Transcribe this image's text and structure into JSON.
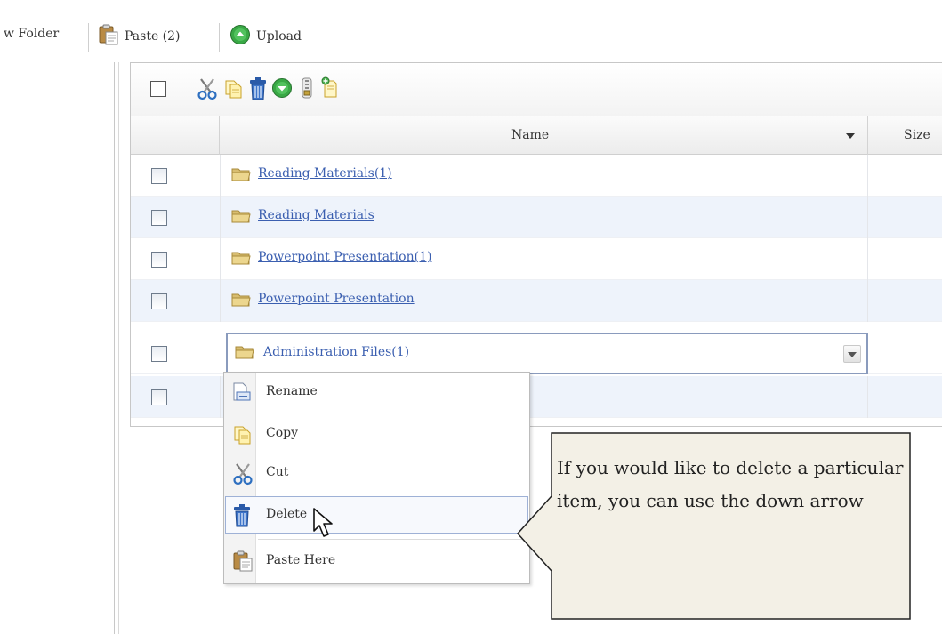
{
  "toolbar": {
    "new_folder_label": "w Folder",
    "paste_label": "Paste (2)",
    "upload_label": "Upload"
  },
  "grid": {
    "columns": {
      "name": "Name",
      "size": "Size"
    },
    "rows": [
      {
        "name": "Reading Materials(1)"
      },
      {
        "name": "Reading Materials"
      },
      {
        "name": "Powerpoint Presentation(1)"
      },
      {
        "name": "Powerpoint Presentation"
      },
      {
        "name": "Administration Files(1)",
        "selected": true
      },
      {
        "name": ""
      }
    ]
  },
  "context_menu": {
    "items": [
      {
        "label": "Rename",
        "icon": "rename-icon"
      },
      {
        "label": "Copy",
        "icon": "copy-icon"
      },
      {
        "label": "Cut",
        "icon": "scissors-icon"
      },
      {
        "label": "Delete",
        "icon": "trash-icon",
        "hover": true
      },
      {
        "label": "Paste Here",
        "icon": "clipboard-icon"
      }
    ]
  },
  "callout": {
    "text": "If you would like to delete a particular item, you can use the down arrow"
  },
  "colors": {
    "link": "#3b5fb0",
    "row_alt": "#eef3fb",
    "callout_bg": "#f3f0e6",
    "folder": "#d8bd70"
  }
}
